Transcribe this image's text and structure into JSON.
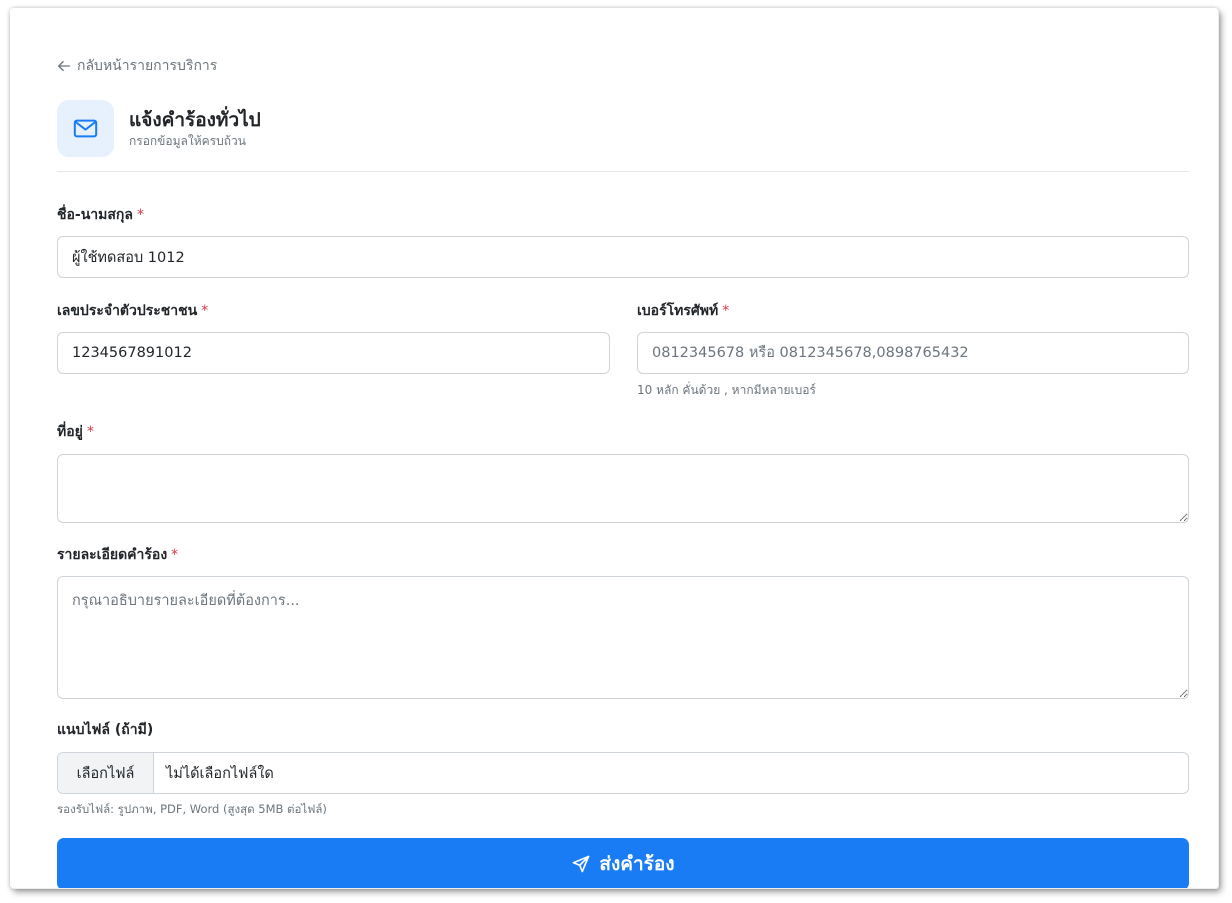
{
  "back_link": {
    "label": "กลับหน้ารายการบริการ"
  },
  "header": {
    "title": "แจ้งคำร้องทั่วไป",
    "subtitle": "กรอกข้อมูลให้ครบถ้วน",
    "icon": "envelope-icon"
  },
  "form": {
    "required_mark": "*",
    "full_name": {
      "label": "ชื่อ-นามสกุล",
      "value": "ผู้ใช้ทดสอบ 1012"
    },
    "citizen_id": {
      "label": "เลขประจำตัวประชาชน",
      "value": "1234567891012"
    },
    "phone": {
      "label": "เบอร์โทรศัพท์",
      "placeholder": "0812345678 หรือ 0812345678,0898765432",
      "help": "10 หลัก คั่นด้วย , หากมีหลายเบอร์"
    },
    "address": {
      "label": "ที่อยู่",
      "value": ""
    },
    "details": {
      "label": "รายละเอียดคำร้อง",
      "placeholder": "กรุณาอธิบายรายละเอียดที่ต้องการ..."
    },
    "attachment": {
      "label": "แนบไฟล์ (ถ้ามี)",
      "button": "เลือกไฟล์",
      "status": "ไม่ได้เลือกไฟล์ใด",
      "help": "รองรับไฟล์: รูปภาพ, PDF, Word (สูงสุด 5MB ต่อไฟล์)"
    }
  },
  "submit": {
    "label": "ส่งคำร้อง",
    "icon": "send-icon"
  },
  "colors": {
    "primary": "#1a7cf5",
    "required": "#dc3545",
    "icon_bg": "#e7f0fd",
    "muted": "#6c757d"
  }
}
